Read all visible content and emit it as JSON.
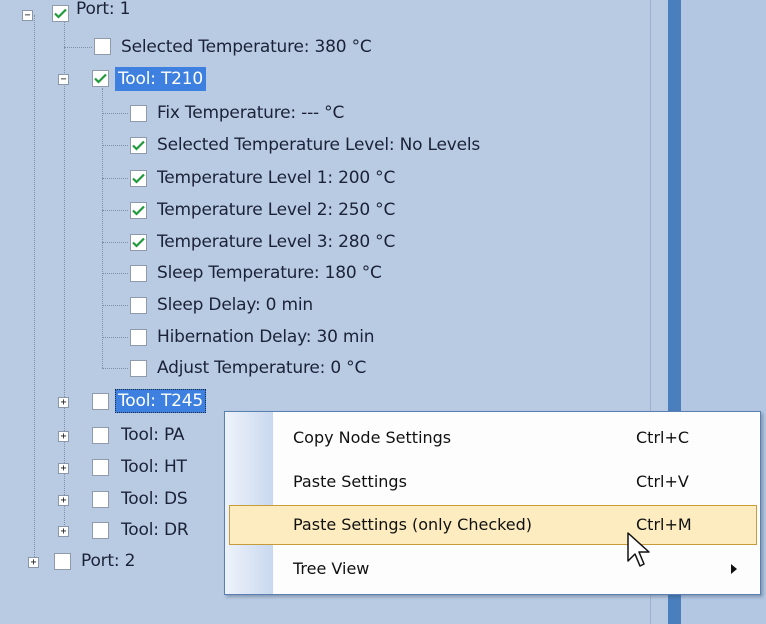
{
  "tree": {
    "port1": {
      "label": "Port: 1",
      "checked": true,
      "expanded": true
    },
    "selected_temperature": {
      "label": "Selected Temperature: 380 °C",
      "checked": false
    },
    "tool_t210": {
      "label": "Tool: T210",
      "checked": true,
      "expanded": true,
      "children": [
        {
          "label": "Fix Temperature: --- °C",
          "checked": false
        },
        {
          "label": "Selected Temperature Level: No Levels",
          "checked": true
        },
        {
          "label": "Temperature Level 1: 200 °C",
          "checked": true
        },
        {
          "label": "Temperature Level 2: 250 °C",
          "checked": true
        },
        {
          "label": "Temperature Level 3: 280 °C",
          "checked": true
        },
        {
          "label": "Sleep Temperature: 180 °C",
          "checked": false
        },
        {
          "label": "Sleep Delay: 0 min",
          "checked": false
        },
        {
          "label": "Hibernation Delay: 30 min",
          "checked": false
        },
        {
          "label": "Adjust Temperature: 0 °C",
          "checked": false
        }
      ]
    },
    "tools": [
      {
        "label": "Tool: T245",
        "checked": false,
        "expanded": false
      },
      {
        "label": "Tool: PA",
        "checked": false,
        "expanded": false
      },
      {
        "label": "Tool: HT",
        "checked": false,
        "expanded": false
      },
      {
        "label": "Tool: DS",
        "checked": false,
        "expanded": false
      },
      {
        "label": "Tool: DR",
        "checked": false,
        "expanded": false
      }
    ],
    "port2": {
      "label": "Port: 2",
      "checked": false,
      "expanded": false
    },
    "expand_glyph": "+",
    "collapse_glyph": "−"
  },
  "context_menu": {
    "items": [
      {
        "label": "Copy Node Settings",
        "shortcut": "Ctrl+C"
      },
      {
        "label": "Paste Settings",
        "shortcut": "Ctrl+V"
      },
      {
        "label": "Paste Settings (only Checked)",
        "shortcut": "Ctrl+M",
        "highlighted": true
      },
      {
        "label": "Tree View",
        "shortcut": "",
        "submenu": true
      }
    ]
  },
  "colors": {
    "background": "#b9cbe3",
    "selection": "#3d80e0",
    "menu_highlight": "#fcecc0",
    "menu_highlight_border": "#c79b3a",
    "pane_divider": "#4a7fbd",
    "check_mark": "#1f9a3a"
  }
}
